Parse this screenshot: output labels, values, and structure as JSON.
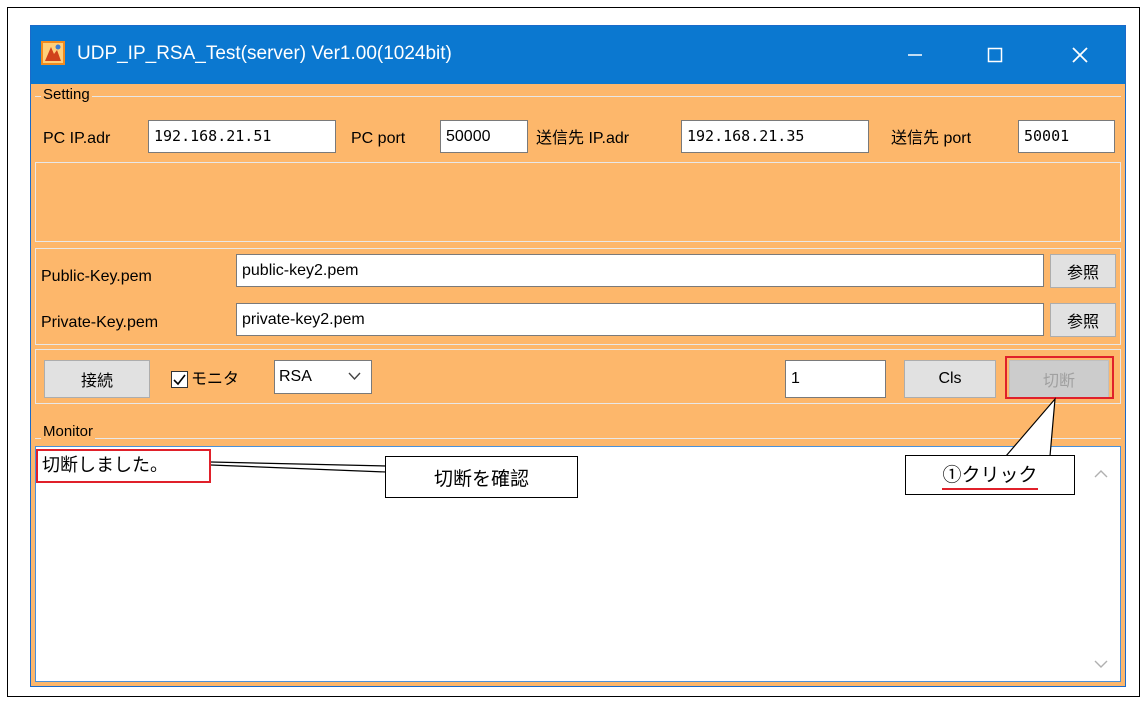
{
  "window": {
    "title": "UDP_IP_RSA_Test(server) Ver1.00(1024bit)",
    "controls": {
      "minimize": "minimize-icon",
      "maximize": "maximize-icon",
      "close": "close-icon"
    }
  },
  "setting": {
    "group_title": "Setting",
    "pc_ip_label": "PC IP.adr",
    "pc_ip_value": "192.168.21.51",
    "pc_port_label": "PC port",
    "pc_port_value": "50000",
    "dest_ip_label": "送信先 IP.adr",
    "dest_ip_value": "192.168.21.35",
    "dest_port_label": "送信先 port",
    "dest_port_value": "50001"
  },
  "keys": {
    "public_label": "Public-Key.pem",
    "public_value": "public-key2.pem",
    "private_label": "Private-Key.pem",
    "private_value": "private-key2.pem",
    "browse_label": "参照"
  },
  "toolbar": {
    "connect_label": "接続",
    "monitor_check_label": "モニタ",
    "monitor_checked": true,
    "mode_value": "RSA",
    "count_value": "1",
    "cls_label": "Cls",
    "disconnect_label": "切断"
  },
  "monitor": {
    "group_title": "Monitor",
    "text": "切断しました。"
  },
  "annotations": {
    "confirm_label": "切断を確認",
    "click_label": "①クリック",
    "highlight_color": "#e0202a"
  },
  "colors": {
    "titlebar": "#0b78d0",
    "window_bg": "#fdb76b",
    "monitor_border": "#4a90d9"
  }
}
